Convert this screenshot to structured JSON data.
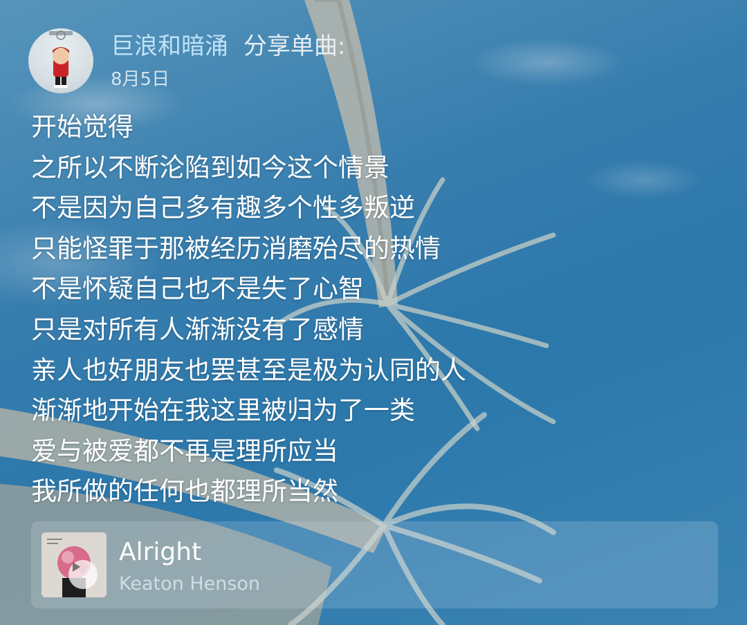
{
  "post": {
    "username": "巨浪和暗涌",
    "share_label": "分享单曲:",
    "date": "8月5日",
    "lyrics": [
      "开始觉得",
      "之所以不断沦陷到如今这个情景",
      "不是因为自己多有趣多个性多叛逆",
      "只能怪罪于那被经历消磨殆尽的热情",
      "不是怀疑自己也不是失了心智",
      "只是对所有人渐渐没有了感情",
      "亲人也好朋友也罢甚至是极为认同的人",
      "渐渐地开始在我这里被归为了一类",
      "爱与被爱都不再是理所应当",
      "我所做的任何也都理所当然"
    ]
  },
  "music_card": {
    "title": "Alright",
    "artist": "Keaton Henson",
    "play_icon": "play-icon"
  },
  "colors": {
    "username": "#bfe2f7",
    "sky": "#2f7fb5",
    "text": "#ffffff"
  }
}
